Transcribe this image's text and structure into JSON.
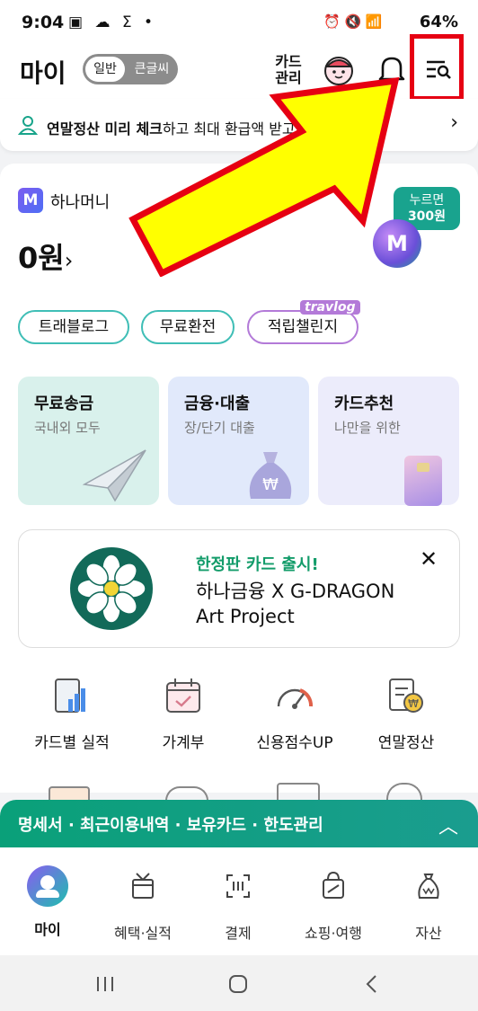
{
  "status": {
    "time": "9:04",
    "battery": "64%",
    "left_icons": "▣ ☁ Σ •",
    "right_icons": "⏰ 🔇 📶"
  },
  "header": {
    "title": "마이",
    "toggle_normal": "일반",
    "toggle_large": "큰글씨",
    "card_mgmt_line1": "카드",
    "card_mgmt_line2": "관리"
  },
  "banner": {
    "bold": "연말정산 미리 체크",
    "rest": "하고 최대 환급액 받고",
    "chevron": "›"
  },
  "money": {
    "badge": "M",
    "name": "하나머니",
    "balance": "0원",
    "balance_arrow": "›",
    "coin_bubble_line1": "누르면",
    "coin_bubble_line2": "300원",
    "coin_letter": "M"
  },
  "pills": [
    "트래블로그",
    "무료환전",
    "적립챌린지"
  ],
  "travlog_tag": "travlog",
  "tiles": [
    {
      "title": "무료송금",
      "sub": "국내외 모두"
    },
    {
      "title": "금융·대출",
      "sub": "장/단기 대출"
    },
    {
      "title": "카드추천",
      "sub": "나만을 위한"
    }
  ],
  "promo": {
    "headline": "한정판 카드 출시!",
    "line1": "하나금융 X G-DRAGON",
    "line2": "Art Project",
    "close": "✕"
  },
  "quick": [
    "카드별 실적",
    "가계부",
    "신용점수UP",
    "연말정산"
  ],
  "greenbar": {
    "text": "명세서 · 최근이용내역 · 보유카드 · 한도관리",
    "chevron": "︿"
  },
  "nav": [
    "마이",
    "혜택·실적",
    "결제",
    "쇼핑·여행",
    "자산"
  ],
  "colors": {
    "brand_teal": "#1a9d8f",
    "accent_red": "#e60012",
    "arrow_yellow": "#ffff00"
  }
}
